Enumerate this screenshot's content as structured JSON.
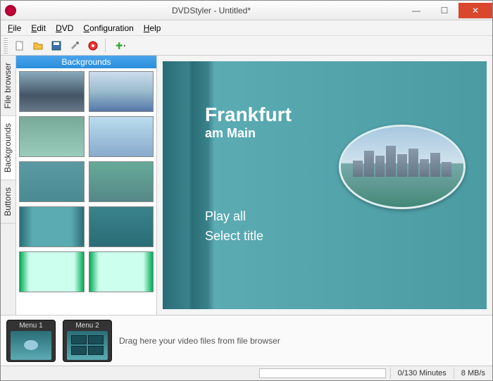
{
  "window": {
    "title": "DVDStyler - Untitled*"
  },
  "menus": {
    "file": "File",
    "edit": "Edit",
    "dvd": "DVD",
    "config": "Configuration",
    "help": "Help"
  },
  "vtabs": {
    "file_browser": "File browser",
    "backgrounds": "Backgrounds",
    "buttons": "Buttons"
  },
  "bg_panel": {
    "header": "Backgrounds"
  },
  "dvd_menu": {
    "title_line1": "Frankfurt",
    "title_line2": "am Main",
    "play_all": "Play all",
    "select_title": "Select title"
  },
  "timeline": {
    "menus": [
      {
        "label": "Menu 1"
      },
      {
        "label": "Menu 2"
      }
    ],
    "drop_hint": "Drag here your video files from file browser"
  },
  "status": {
    "time": "0/130 Minutes",
    "rate": "8 MB/s"
  },
  "icons": {
    "new": "new-icon",
    "open": "open-icon",
    "save": "save-icon",
    "settings": "settings-icon",
    "burn": "burn-icon",
    "add": "add-icon"
  }
}
